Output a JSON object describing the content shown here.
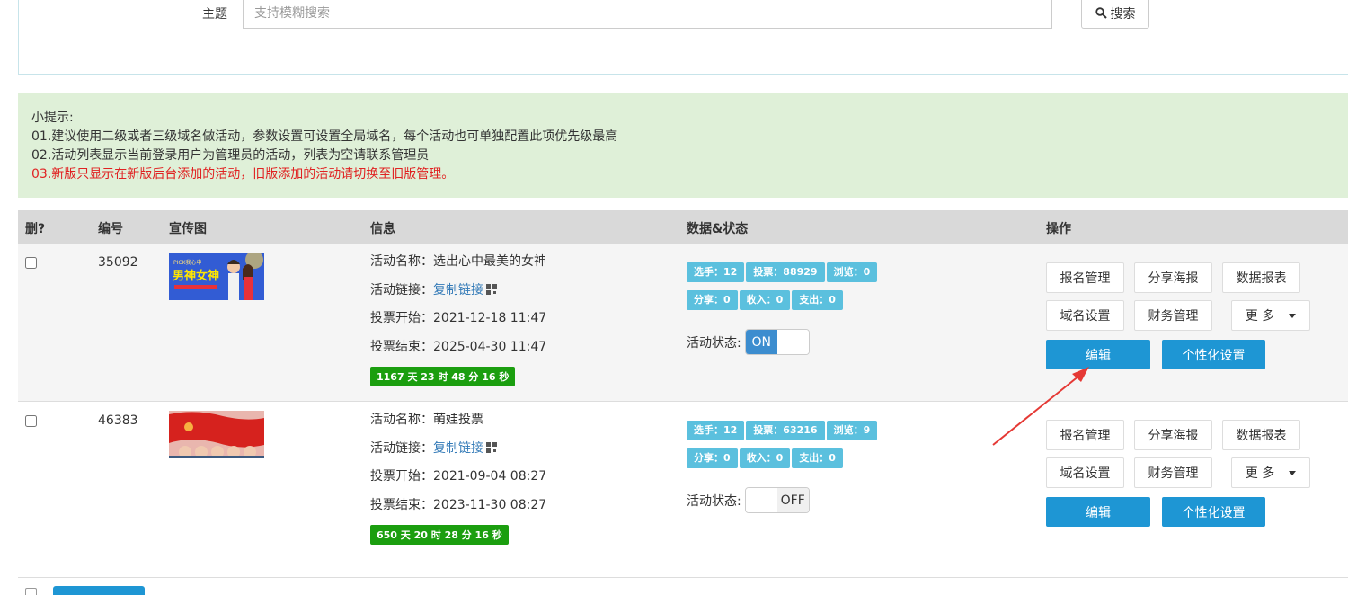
{
  "search": {
    "label": "主题",
    "placeholder": "支持模糊搜索",
    "button_label": "搜索"
  },
  "tips": {
    "title": "小提示:",
    "line1": "01.建议使用二级或者三级域名做活动，参数设置可设置全局域名，每个活动也可单独配置此项优先级最高",
    "line2": "02.活动列表显示当前登录用户为管理员的活动，列表为空请联系管理员",
    "line3": "03.新版只显示在新版后台添加的活动，旧版添加的活动请切换至旧版管理。"
  },
  "table": {
    "headers": {
      "delete": "删?",
      "id": "编号",
      "poster": "宣传图",
      "info": "信息",
      "data_status": "数据&状态",
      "actions": "操作"
    },
    "rows": [
      {
        "id": "35092",
        "poster_text": "男神女神",
        "info": {
          "name_label": "活动名称：",
          "name": "选出心中最美的女神",
          "link_label": "活动链接：",
          "link_text": "复制链接",
          "start_label": "投票开始：",
          "start": "2021-12-18 11:47",
          "end_label": "投票结束：",
          "end": "2025-04-30 11:47",
          "countdown": "1167 天 23 时 48 分 16 秒"
        },
        "stats": {
          "players": "选手：12",
          "votes": "投票：88929",
          "views": "浏览：0",
          "shares": "分享：0",
          "income": "收入：0",
          "expense": "支出：0"
        },
        "status_label": "活动状态:",
        "status": "ON",
        "actions": {
          "signup": "报名管理",
          "share_poster": "分享海报",
          "report": "数据报表",
          "domain": "域名设置",
          "finance": "财务管理",
          "more": "更 多",
          "edit": "编辑",
          "custom": "个性化设置"
        }
      },
      {
        "id": "46383",
        "info": {
          "name_label": "活动名称：",
          "name": "萌娃投票",
          "link_label": "活动链接：",
          "link_text": "复制链接",
          "start_label": "投票开始：",
          "start": "2021-09-04 08:27",
          "end_label": "投票结束：",
          "end": "2023-11-30 08:27",
          "countdown": "650 天 20 时 28 分 16 秒"
        },
        "stats": {
          "players": "选手：12",
          "votes": "投票：63216",
          "views": "浏览：9",
          "shares": "分享：0",
          "income": "收入：0",
          "expense": "支出：0"
        },
        "status_label": "活动状态:",
        "status": "OFF",
        "actions": {
          "signup": "报名管理",
          "share_poster": "分享海报",
          "report": "数据报表",
          "domain": "域名设置",
          "finance": "财务管理",
          "more": "更 多",
          "edit": "编辑",
          "custom": "个性化设置"
        }
      }
    ]
  },
  "colors": {
    "primary": "#1e96d4",
    "badge": "#5bc0de",
    "countdown": "#1b9e0f",
    "tip_bg": "#dff0d8",
    "warning_text": "#e02222",
    "annotation_arrow": "#e53935"
  }
}
